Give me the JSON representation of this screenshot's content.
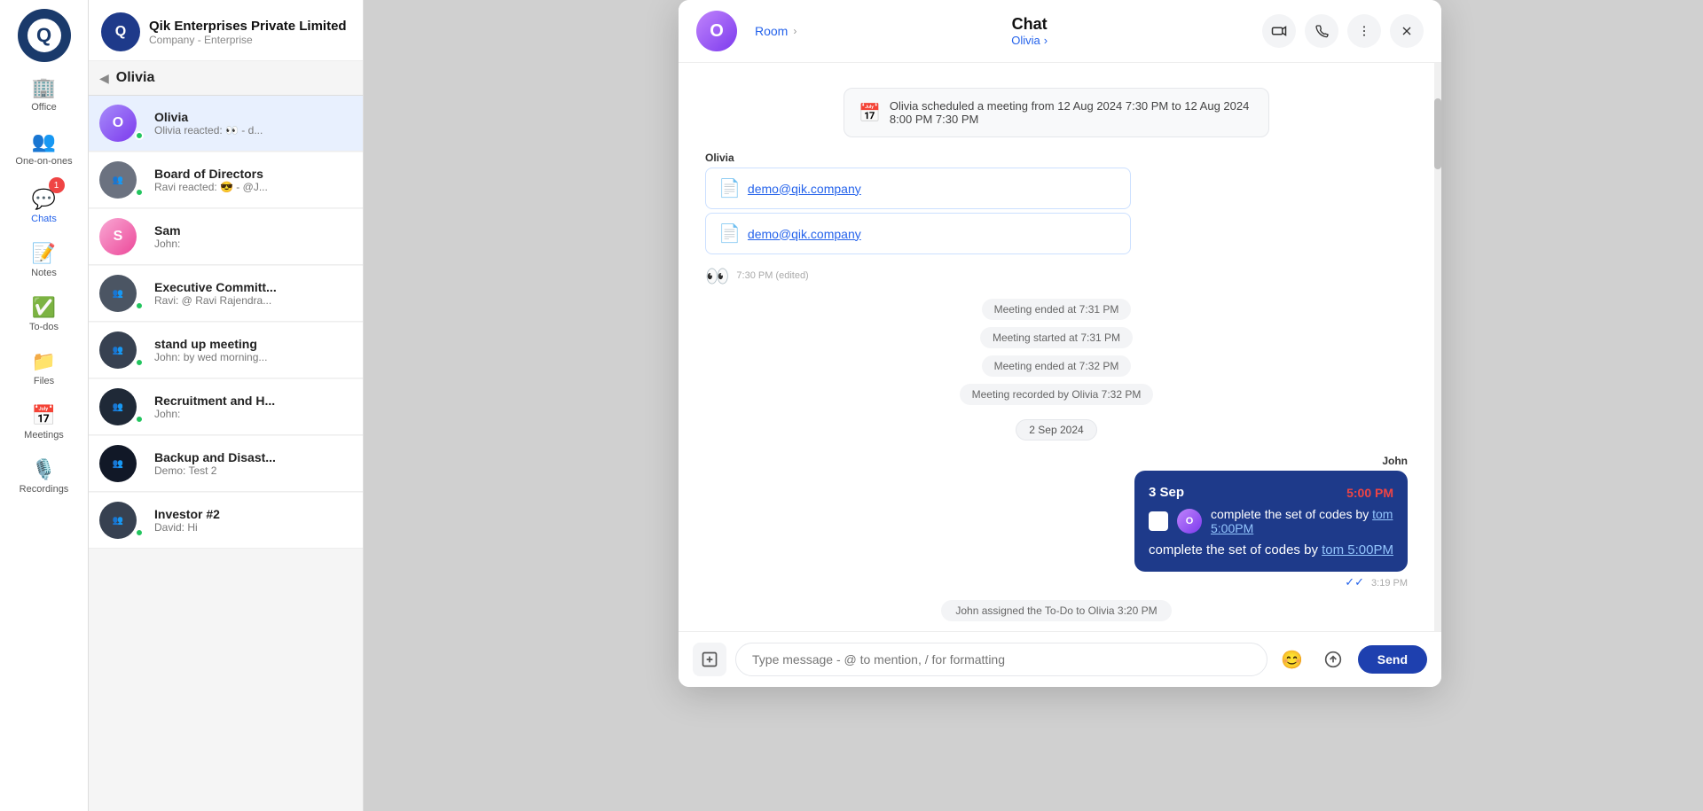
{
  "app": {
    "company_name": "Qik Enterprises Private Limited",
    "company_sub": "Company - Enterprise"
  },
  "sidebar": {
    "items": [
      {
        "id": "office",
        "label": "Office",
        "icon": "🏢",
        "active": false
      },
      {
        "id": "one-on-ones",
        "label": "One-on-ones",
        "icon": "👥",
        "active": false
      },
      {
        "id": "chats",
        "label": "Chats",
        "icon": "💬",
        "active": true,
        "badge": "1"
      },
      {
        "id": "notes",
        "label": "Notes",
        "icon": "📝",
        "active": false
      },
      {
        "id": "todos",
        "label": "To-dos",
        "icon": "✅",
        "active": false
      },
      {
        "id": "files",
        "label": "Files",
        "icon": "📁",
        "active": false
      },
      {
        "id": "meetings",
        "label": "Meetings",
        "icon": "📅",
        "active": false
      },
      {
        "id": "recordings",
        "label": "Recordings",
        "icon": "🎙️",
        "active": false
      }
    ]
  },
  "contact_panel": {
    "title": "Olivia",
    "contacts": [
      {
        "id": "olivia",
        "name": "Olivia",
        "preview": "Olivia reacted: 👀 - d...",
        "avatar_letter": "O",
        "avatar_class": "av-olivia",
        "online": true
      },
      {
        "id": "board",
        "name": "Board of Directors",
        "preview": "Ravi reacted: 😎 - @J...",
        "avatar_class": "av-board",
        "group": true,
        "online": true
      },
      {
        "id": "sam",
        "name": "Sam",
        "preview": "John:",
        "avatar_letter": "S",
        "avatar_class": "av-sam",
        "online": false
      },
      {
        "id": "exec",
        "name": "Executive Committ...",
        "preview": "Ravi: @ Ravi Rajendra...",
        "avatar_class": "av-exec",
        "group": true,
        "online": true
      },
      {
        "id": "standup",
        "name": "stand up meeting",
        "preview": "John: by wed morning...",
        "avatar_class": "av-standup",
        "group": true,
        "online": true
      },
      {
        "id": "recruit",
        "name": "Recruitment and H...",
        "preview": "John:",
        "avatar_class": "av-recruit",
        "group": true,
        "online": true
      },
      {
        "id": "backup",
        "name": "Backup and Disast...",
        "preview": "Demo: Test 2",
        "avatar_class": "av-backup",
        "group": true,
        "online": false
      },
      {
        "id": "investor",
        "name": "Investor #2",
        "preview": "David: Hi",
        "avatar_class": "av-investor",
        "group": true,
        "online": true
      }
    ]
  },
  "chat": {
    "title": "Chat",
    "subtitle": "Olivia",
    "subtitle_arrow": "›",
    "breadcrumb_room": "Room",
    "breadcrumb_arrow": "›",
    "header_avatar_letter": "O",
    "messages": [
      {
        "id": "scheduled",
        "type": "system_card",
        "text": "Olivia scheduled a meeting from 12 Aug 2024 7:30 PM to 12 Aug 2024 8:00 PM 7:30 PM"
      },
      {
        "id": "olivia-files",
        "type": "files",
        "sender": "Olivia",
        "files": [
          "demo@qik.company",
          "demo@qik.company"
        ],
        "time": "7:30 PM",
        "edited": true,
        "reaction": "👀"
      },
      {
        "id": "meeting-end1",
        "type": "system",
        "text": "Meeting ended at 7:31 PM"
      },
      {
        "id": "meeting-start1",
        "type": "system",
        "text": "Meeting started at 7:31 PM"
      },
      {
        "id": "meeting-end2",
        "type": "system",
        "text": "Meeting ended at 7:32 PM"
      },
      {
        "id": "meeting-recorded",
        "type": "system",
        "text": "Meeting recorded by Olivia 7:32 PM"
      },
      {
        "id": "date-sep",
        "type": "date",
        "text": "2 Sep 2024"
      },
      {
        "id": "todo-msg",
        "type": "todo",
        "sender": "John",
        "todo_date": "3 Sep",
        "todo_time": "5:00 PM",
        "todo_text": "complete the set of codes by",
        "todo_link": "tom",
        "todo_link2": "5:00PM",
        "todo_body": "complete the set of codes by",
        "todo_body_link": "tom 5:00PM",
        "time": "3:19 PM",
        "checked": false
      },
      {
        "id": "assignment",
        "type": "system",
        "text": "John assigned the To-Do to Olivia 3:20 PM"
      }
    ],
    "input_placeholder": "Type message - @ to mention, / for formatting",
    "send_label": "Send"
  }
}
